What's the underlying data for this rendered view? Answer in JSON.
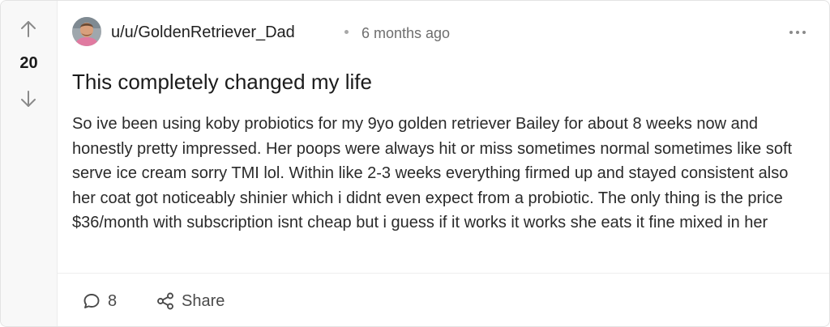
{
  "post": {
    "vote_count": "20",
    "author": "u/u/GoldenRetriever_Dad",
    "separator": "•",
    "timestamp": "6 months ago",
    "title": "This completely changed my life",
    "body": " So ive been using koby probiotics for my 9yo golden retriever Bailey for about 8 weeks now and honestly pretty impressed. Her poops were always hit or miss sometimes normal sometimes like soft serve ice cream sorry TMI lol. Within like 2-3 weeks everything firmed up and stayed consistent also her coat got noticeably shinier which i didnt even expect from a probiotic. The only thing is the price $36/month with subscription isnt cheap but i guess if it works it works she eats it fine mixed in her"
  },
  "actions": {
    "comment_count": "8",
    "share_label": "Share"
  },
  "icons": {
    "upvote": "arrow-up-icon",
    "downvote": "arrow-down-icon",
    "more": "more-horizontal-icon",
    "comment": "comment-bubble-icon",
    "share": "share-icon"
  },
  "colors": {
    "vote_column_bg": "#f8f8f8",
    "text": "#1f1f1f",
    "muted": "#6e6e6e",
    "icon": "#8a8a8a"
  }
}
